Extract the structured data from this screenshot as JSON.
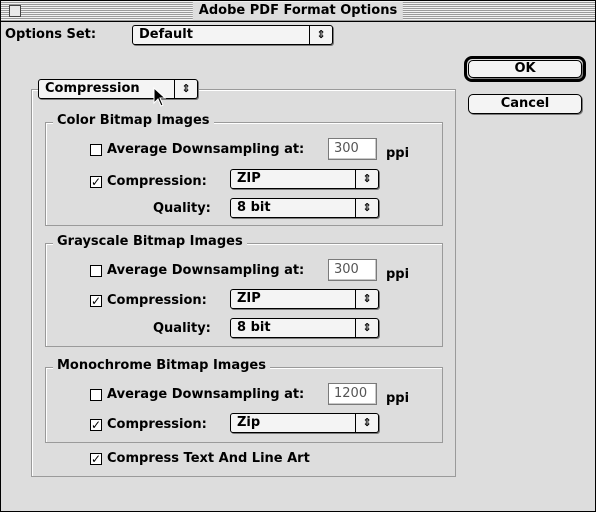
{
  "window": {
    "title": "Adobe PDF Format Options"
  },
  "options_set": {
    "label": "Options Set:",
    "value": "Default"
  },
  "section_popup": {
    "value": "Compression"
  },
  "buttons": {
    "ok": "OK",
    "cancel": "Cancel"
  },
  "groups": [
    {
      "title": "Color Bitmap Images",
      "downsample": {
        "label": "Average Downsampling at:",
        "checked": false,
        "value": "300",
        "unit": "ppi"
      },
      "compression": {
        "label": "Compression:",
        "checked": true,
        "value": "ZIP"
      },
      "quality": {
        "label": "Quality:",
        "value": "8 bit"
      }
    },
    {
      "title": "Grayscale Bitmap Images",
      "downsample": {
        "label": "Average Downsampling at:",
        "checked": false,
        "value": "300",
        "unit": "ppi"
      },
      "compression": {
        "label": "Compression:",
        "checked": true,
        "value": "ZIP"
      },
      "quality": {
        "label": "Quality:",
        "value": "8 bit"
      }
    },
    {
      "title": "Monochrome Bitmap Images",
      "downsample": {
        "label": "Average Downsampling at:",
        "checked": false,
        "value": "1200",
        "unit": "ppi"
      },
      "compression": {
        "label": "Compression:",
        "checked": true,
        "value": "Zip"
      }
    }
  ],
  "compress_text": {
    "label": "Compress Text And Line Art",
    "checked": true
  },
  "glyphs": {
    "check": "✓",
    "updown": "⇕"
  }
}
